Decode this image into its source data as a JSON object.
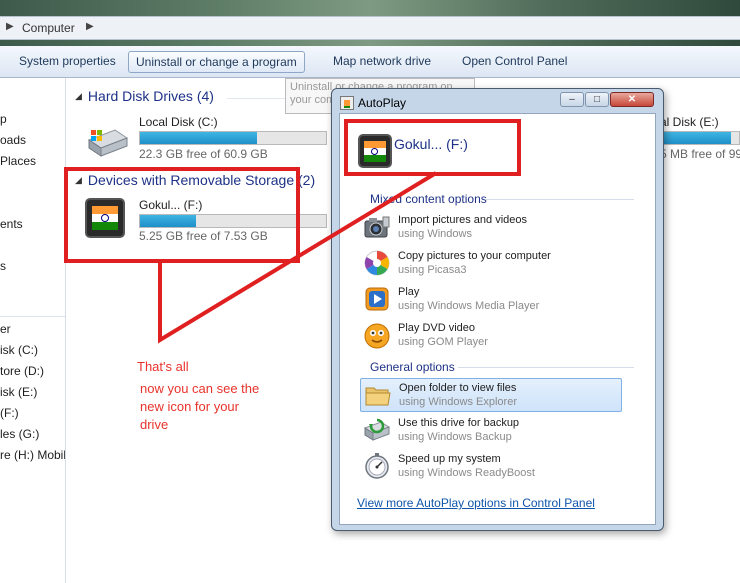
{
  "address_bar": {
    "crumb": "Computer"
  },
  "toolbar": {
    "buttons": [
      {
        "label": "System properties"
      },
      {
        "label": "Uninstall or change a program"
      },
      {
        "label": "Map network drive"
      },
      {
        "label": "Open Control Panel"
      }
    ]
  },
  "tooltip": {
    "text": "Uninstall or change a program on your computer"
  },
  "nav": {
    "items": [
      "p",
      "oads",
      "Places",
      "ents",
      "s",
      "er",
      "isk (C:)",
      "tore (D:)",
      "isk (E:)",
      "(F:)",
      "les (G:)",
      "re (H:) Mobil"
    ]
  },
  "hard_disk_drives": {
    "heading": "Hard Disk Drives (4)",
    "local_c": {
      "name": "Local Disk (C:)",
      "free": "22.3 GB free of 60.9 GB",
      "used_fraction": 0.63
    },
    "local_e": {
      "name": "al Disk (E:)",
      "free": "5 MB free of 99",
      "used_fraction": 0.9
    }
  },
  "removable": {
    "heading": "Devices with Removable Storage (2)",
    "drive_f": {
      "name": "Gokul... (F:)",
      "free": "5.25 GB free of 7.53 GB",
      "used_fraction": 0.3
    }
  },
  "annotation": {
    "line1": "That's all",
    "line2": "now you can see the",
    "line3": "new icon for your",
    "line4": "drive",
    "color": "#e8332b"
  },
  "autoplay": {
    "title": "AutoPlay",
    "drive_label": "Gokul... (F:)",
    "mixed_heading": "Mixed content options",
    "general_heading": "General options",
    "options": [
      {
        "label": "Import pictures and videos",
        "sub": "using Windows",
        "icon": "camera-icon"
      },
      {
        "label": "Copy pictures to your computer",
        "sub": "using Picasa3",
        "icon": "picasa-icon"
      },
      {
        "label": "Play",
        "sub": "using Windows Media Player",
        "icon": "media-player-icon"
      },
      {
        "label": "Play DVD video",
        "sub": "using GOM Player",
        "icon": "gom-player-icon"
      },
      {
        "label": "Open folder to view files",
        "sub": "using Windows Explorer",
        "icon": "folder-icon"
      },
      {
        "label": "Use this drive for backup",
        "sub": "using Windows Backup",
        "icon": "backup-icon"
      },
      {
        "label": "Speed up my system",
        "sub": "using Windows ReadyBoost",
        "icon": "readyboost-icon"
      }
    ],
    "more_link": "View more AutoPlay options in Control Panel"
  }
}
